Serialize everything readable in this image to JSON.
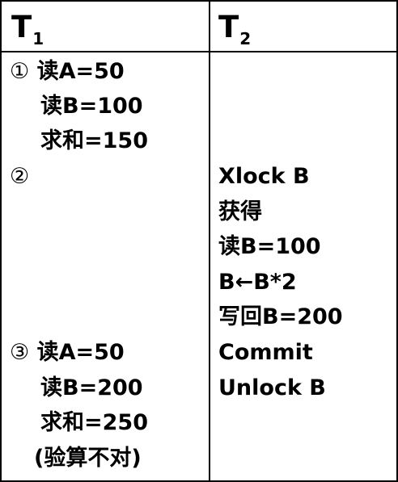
{
  "headers": {
    "t1_main": "T",
    "t1_sub": "1",
    "t2_main": "T",
    "t2_sub": "2"
  },
  "left": [
    {
      "marker": "①",
      "text": "读A=50"
    },
    {
      "text": "读B=100"
    },
    {
      "text": "求和=150"
    },
    {
      "marker": "②"
    },
    {
      "marker": "③",
      "text": "读A=50"
    },
    {
      "text": "读B=200"
    },
    {
      "text": "求和=250"
    },
    {
      "text": "(验算不对)"
    }
  ],
  "right": [
    "Xlock B",
    "获得",
    "读B=100",
    "B←B*2",
    "写回B=200",
    "Commit",
    "Unlock B"
  ]
}
